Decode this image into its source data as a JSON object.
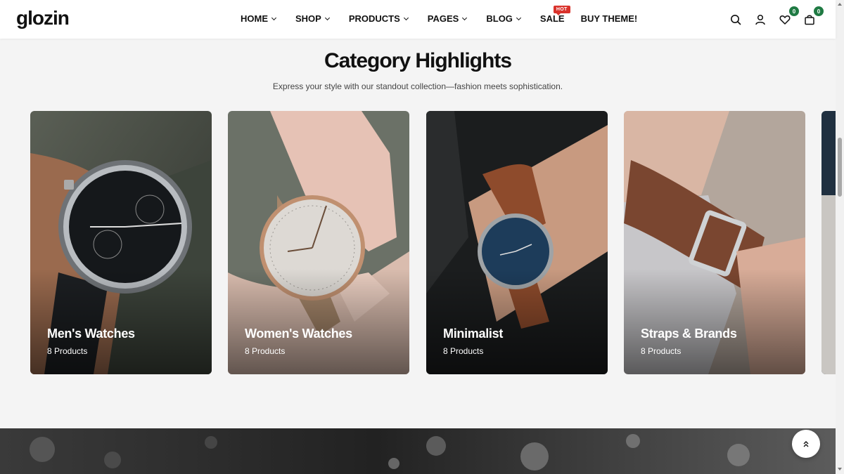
{
  "header": {
    "logo": "glozin",
    "nav": [
      {
        "label": "HOME",
        "dropdown": true
      },
      {
        "label": "SHOP",
        "dropdown": true
      },
      {
        "label": "PRODUCTS",
        "dropdown": true
      },
      {
        "label": "PAGES",
        "dropdown": true
      },
      {
        "label": "BLOG",
        "dropdown": true
      },
      {
        "label": "SALE",
        "dropdown": false,
        "badge": "HOT"
      },
      {
        "label": "BUY THEME!",
        "dropdown": false
      }
    ],
    "icons": [
      "search-icon",
      "user-icon",
      "wishlist-icon",
      "cart-icon"
    ],
    "wishlist_count": "0",
    "cart_count": "0"
  },
  "section": {
    "title": "Category Highlights",
    "subtitle": "Express your style with our standout collection—fashion meets sophistication."
  },
  "categories": [
    {
      "name": "Men's Watches",
      "count": "8 Products"
    },
    {
      "name": "Women's Watches",
      "count": "8 Products"
    },
    {
      "name": "Minimalist",
      "count": "8 Products"
    },
    {
      "name": "Straps & Brands",
      "count": "8 Products"
    }
  ],
  "colors": {
    "accent_badge": "#d9322b",
    "count_badge": "#1f7a43",
    "page_bg": "#f4f4f4"
  }
}
